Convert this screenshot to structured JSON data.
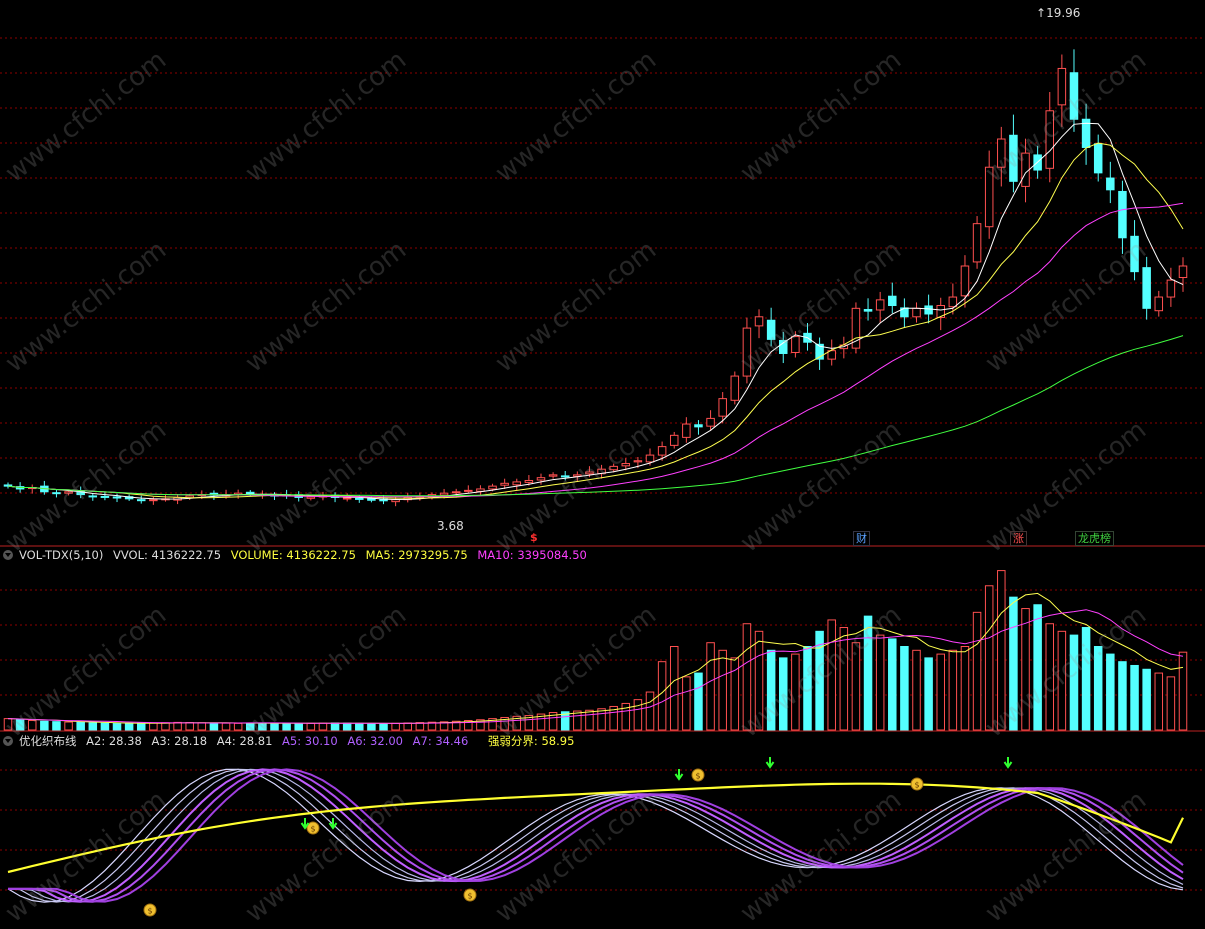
{
  "watermark": "www.cfchi.com",
  "price_panel": {
    "high_label": "19.96",
    "low_label": "3.68",
    "markers": [
      {
        "text": "$",
        "color": "#ff3030"
      },
      {
        "text": "财",
        "color": "#5aa0ff"
      },
      {
        "text": "涨",
        "color": "#ff5050"
      },
      {
        "text": "龙虎榜",
        "color": "#40d040"
      }
    ]
  },
  "volume_panel": {
    "name": "VOL-TDX(5,10)",
    "items": [
      {
        "label": "VVOL: 4136222.75",
        "color": "#dddddd"
      },
      {
        "label": "VOLUME: 4136222.75",
        "color": "#ffff40"
      },
      {
        "label": "MA5: 2973295.75",
        "color": "#ffff40"
      },
      {
        "label": "MA10: 3395084.50",
        "color": "#ff40ff"
      }
    ]
  },
  "indicator_panel": {
    "name": "优化织布线",
    "items": [
      {
        "label": "A2: 28.38",
        "color": "#dddddd"
      },
      {
        "label": "A3: 28.18",
        "color": "#dddddd"
      },
      {
        "label": "A4: 28.81",
        "color": "#dddddd"
      },
      {
        "label": "A5: 30.10",
        "color": "#b060ff"
      },
      {
        "label": "A6: 32.00",
        "color": "#b060ff"
      },
      {
        "label": "A7: 34.46",
        "color": "#b060ff"
      },
      {
        "label": "强弱分界: 58.95",
        "color": "#ffff40"
      }
    ]
  },
  "colors": {
    "up": "#ff5050",
    "down": "#54ffff",
    "ma5": "#ffffff",
    "ma10": "#ffff50",
    "ma20": "#ff40ff",
    "ma60": "#40ff40",
    "grid": "#8b0000",
    "boundary": "#ffff30"
  },
  "chart_data": {
    "type": "candlestick",
    "count": 98,
    "price_range": [
      3.0,
      21.0
    ],
    "x_ticks_at_markers": [
      44,
      71,
      84,
      90
    ],
    "closes": [
      4.2,
      4.1,
      4.15,
      4.0,
      3.95,
      4.0,
      3.9,
      3.85,
      3.8,
      3.78,
      3.75,
      3.7,
      3.72,
      3.75,
      3.8,
      3.85,
      3.9,
      3.88,
      3.9,
      3.95,
      3.92,
      3.9,
      3.88,
      3.85,
      3.8,
      3.82,
      3.85,
      3.8,
      3.78,
      3.75,
      3.7,
      3.68,
      3.72,
      3.8,
      3.85,
      3.9,
      3.95,
      4.0,
      4.05,
      4.1,
      4.2,
      4.3,
      4.35,
      4.4,
      4.5,
      4.6,
      4.55,
      4.6,
      4.7,
      4.8,
      4.9,
      5.0,
      5.1,
      5.3,
      5.6,
      6.0,
      6.4,
      6.3,
      6.6,
      7.3,
      8.1,
      9.8,
      10.2,
      9.4,
      8.9,
      9.5,
      9.3,
      8.7,
      9.0,
      9.2,
      10.5,
      10.4,
      10.8,
      10.6,
      10.2,
      10.5,
      10.3,
      10.6,
      10.9,
      12.0,
      13.5,
      15.5,
      16.5,
      15.0,
      16.0,
      15.4,
      17.5,
      19.0,
      17.2,
      16.2,
      15.3,
      14.7,
      13.0,
      11.8,
      10.5,
      10.9,
      11.5,
      12.0
    ],
    "volumes": [
      300,
      280,
      250,
      230,
      220,
      210,
      200,
      190,
      180,
      170,
      175,
      180,
      185,
      190,
      200,
      195,
      190,
      185,
      180,
      175,
      180,
      185,
      180,
      175,
      170,
      175,
      180,
      185,
      180,
      175,
      170,
      165,
      175,
      185,
      195,
      205,
      215,
      230,
      250,
      270,
      300,
      330,
      360,
      380,
      420,
      460,
      480,
      500,
      520,
      560,
      620,
      700,
      800,
      1000,
      1800,
      2200,
      1400,
      1500,
      2300,
      2100,
      1900,
      2800,
      2600,
      2100,
      1900,
      2000,
      2200,
      2600,
      2900,
      2700,
      2300,
      3000,
      2500,
      2400,
      2200,
      2100,
      1900,
      2000,
      2100,
      2200,
      3100,
      3800,
      4200,
      3500,
      3200,
      3300,
      2800,
      2600,
      2500,
      2700,
      2200,
      2000,
      1800,
      1700,
      1600,
      1500,
      1400,
      2050
    ],
    "boundary_start": 25,
    "boundary_end": 58.95,
    "a_values_last": {
      "A2": 28.38,
      "A3": 28.18,
      "A4": 28.81,
      "A5": 30.1,
      "A6": 32.0,
      "A7": 34.46
    }
  }
}
